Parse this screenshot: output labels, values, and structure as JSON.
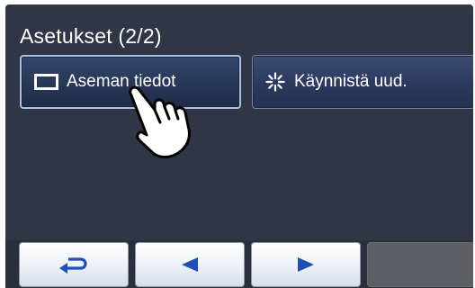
{
  "header": {
    "title": "Asetukset (2/2)"
  },
  "menu": {
    "station_info_label": "Aseman tiedot",
    "restart_label": "Käynnistä uud."
  },
  "icons": {
    "station_info": "rectangle-outline-icon",
    "restart": "spark-burst-icon",
    "back": "return-arrow-icon",
    "previous": "triangle-left-icon",
    "next": "triangle-right-icon",
    "pointer": "pointing-hand-icon"
  },
  "colors": {
    "screen_background": "#313646",
    "button_background": "#2b3a5c",
    "button_border": "#6f84ad",
    "nav_button": "#eef2f7",
    "nav_arrow": "#1f4fb5",
    "nav_disabled": "#5c5e63"
  }
}
